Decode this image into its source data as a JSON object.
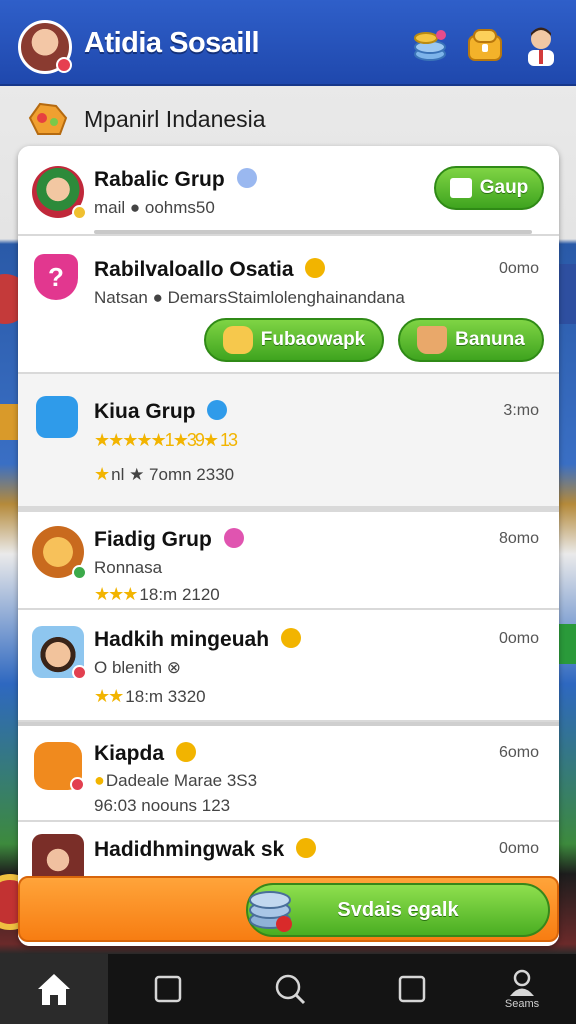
{
  "header": {
    "title": "Atidia Sosaill",
    "icons": [
      "avatar",
      "coins-icon",
      "chest-icon",
      "profile-icon"
    ]
  },
  "region": {
    "label": "Mpanirl Indanesia",
    "icon": "region-badge-icon"
  },
  "groups": [
    {
      "name": "Rabalic Grup",
      "sub": "mail ● oohms50",
      "button": "Gaup",
      "icon": "group-avatar"
    },
    {
      "name": "Rabilvaloallo Osatia",
      "sub": "Natsan ● DemarsStaimlolenghainandana",
      "time": "0omo",
      "buttons": [
        "Fubaowapk",
        "Banuna"
      ],
      "icon": "question-icon"
    },
    {
      "name": "Kiua Grup",
      "sub": "★★★★★1★39★ 13",
      "sub2": "nl ★ 7omn 2330",
      "time": "3:mo",
      "icon": "chat-icon"
    },
    {
      "name": "Fiadig Grup",
      "sub": "Ronnasa",
      "sub2": "18:m 2120",
      "time": "8omo",
      "icon": "lion-avatar"
    },
    {
      "name": "Hadkih mingeuah",
      "sub": "O blenith ⊗",
      "sub2": "18:m 3320",
      "time": "0omo",
      "icon": "man-avatar"
    },
    {
      "name": "Kiapda",
      "sub": "Dadeale Marae 3S3",
      "sub2": "96:03 noouns 123",
      "time": "6omo",
      "icon": "bubble-icon"
    },
    {
      "name": "Hadidhmingwak sk",
      "time": "0omo",
      "icon": "woman-avatar"
    }
  ],
  "action": {
    "label": "Svdais egalk",
    "icon": "coins-stack-icon"
  },
  "nav": {
    "items": [
      {
        "id": "home",
        "icon": "home-icon",
        "label": ""
      },
      {
        "id": "tab2",
        "icon": "square-icon",
        "label": ""
      },
      {
        "id": "search",
        "icon": "search-icon",
        "label": ""
      },
      {
        "id": "tab4",
        "icon": "square-icon",
        "label": ""
      },
      {
        "id": "profile",
        "icon": "person-icon",
        "label": "Seams"
      }
    ]
  },
  "colors": {
    "header": "#2f5fc9",
    "green_button": "#4aae22",
    "orange_bar": "#f77d12",
    "star": "#f2b400"
  }
}
